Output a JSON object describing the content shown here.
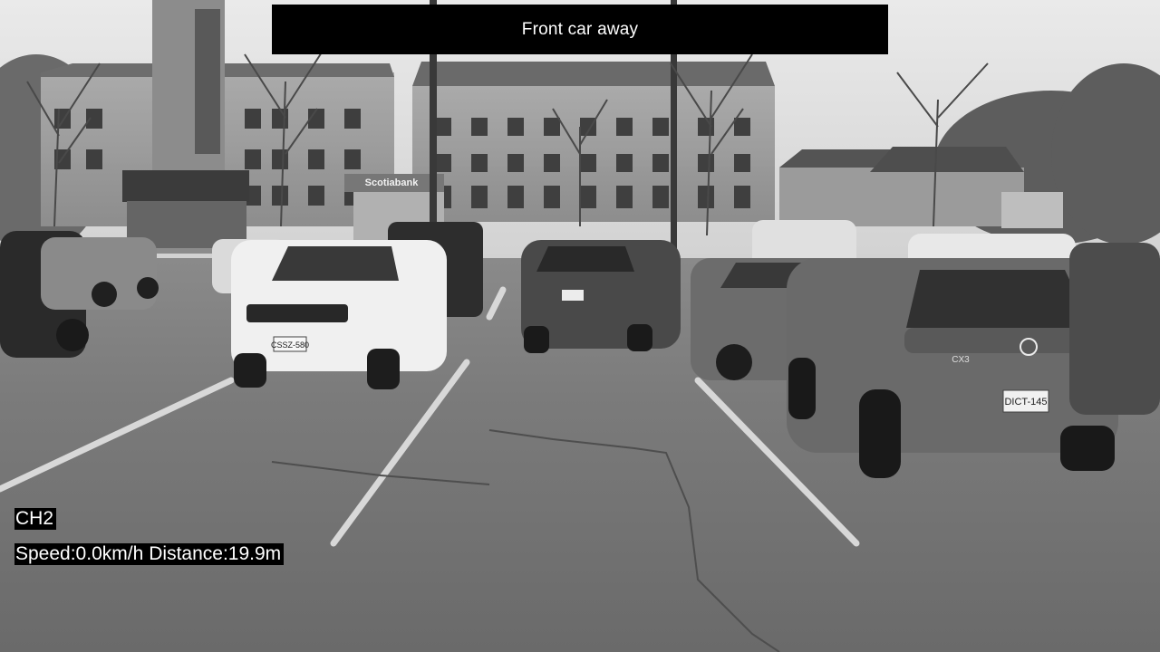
{
  "banner": {
    "text": "Front car away"
  },
  "osd": {
    "channel": "CH2",
    "speed": "Speed:0.0km/h",
    "distance": "Distance:19.9m"
  },
  "scene": {
    "storefront_sign": "Scotiabank",
    "rear_plate_right_suv": "DICT-145",
    "rear_plate_center_suv": "SSB-958",
    "front_plate_white_jeep": "CSSZ-580",
    "vehicle_badge": "CX3"
  }
}
